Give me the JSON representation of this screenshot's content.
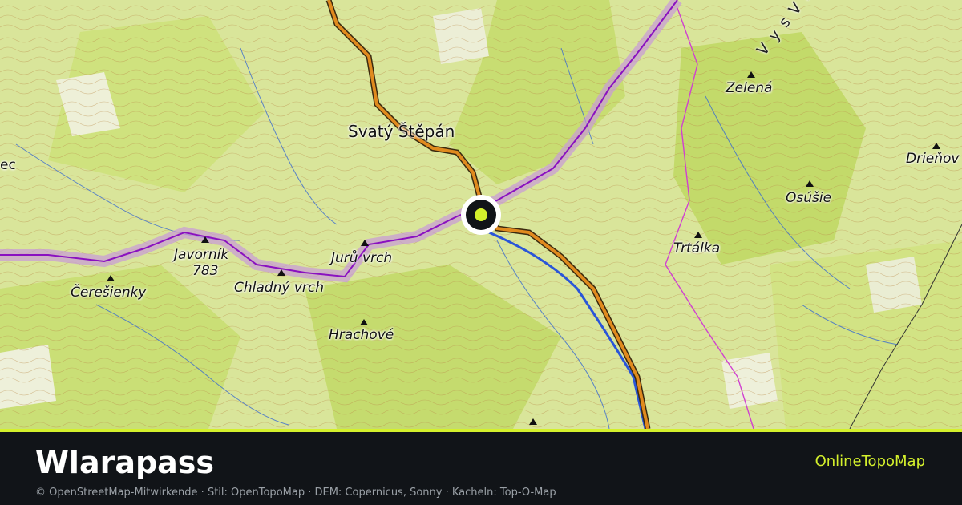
{
  "map": {
    "places": [
      {
        "name": "Svatý Štěpán",
        "kind": "village"
      },
      {
        "name": "Javorník",
        "elevation": "783",
        "kind": "peak"
      },
      {
        "name": "Čerešienky",
        "kind": "peak"
      },
      {
        "name": "Chladný vrch",
        "kind": "peak"
      },
      {
        "name": "Jurů vrch",
        "kind": "peak"
      },
      {
        "name": "Hrachové",
        "kind": "peak"
      },
      {
        "name": "Zelená",
        "kind": "peak"
      },
      {
        "name": "Osúšie",
        "kind": "peak"
      },
      {
        "name": "Trtálka",
        "kind": "peak"
      },
      {
        "name": "Drieňov",
        "kind": "peak"
      },
      {
        "name": "ec",
        "kind": "cut-off"
      }
    ],
    "range_label": "V y s   V r š a t s k",
    "colors": {
      "terrain": "#d9e59a",
      "forest": "#c6dc6e",
      "contour": "#b5783a",
      "border": "#a020c0",
      "road": "#e08a1e",
      "river": "#2a55d8",
      "marker": "#d4f02c"
    },
    "marker_icon": "location-marker-icon"
  },
  "footer": {
    "title": "Wlarapass",
    "brand": "OnlineTopoMap",
    "attribution": "© OpenStreetMap-Mitwirkende · Stil: OpenTopoMap · DEM: Copernicus, Sonny · Kacheln: Top-O-Map"
  }
}
